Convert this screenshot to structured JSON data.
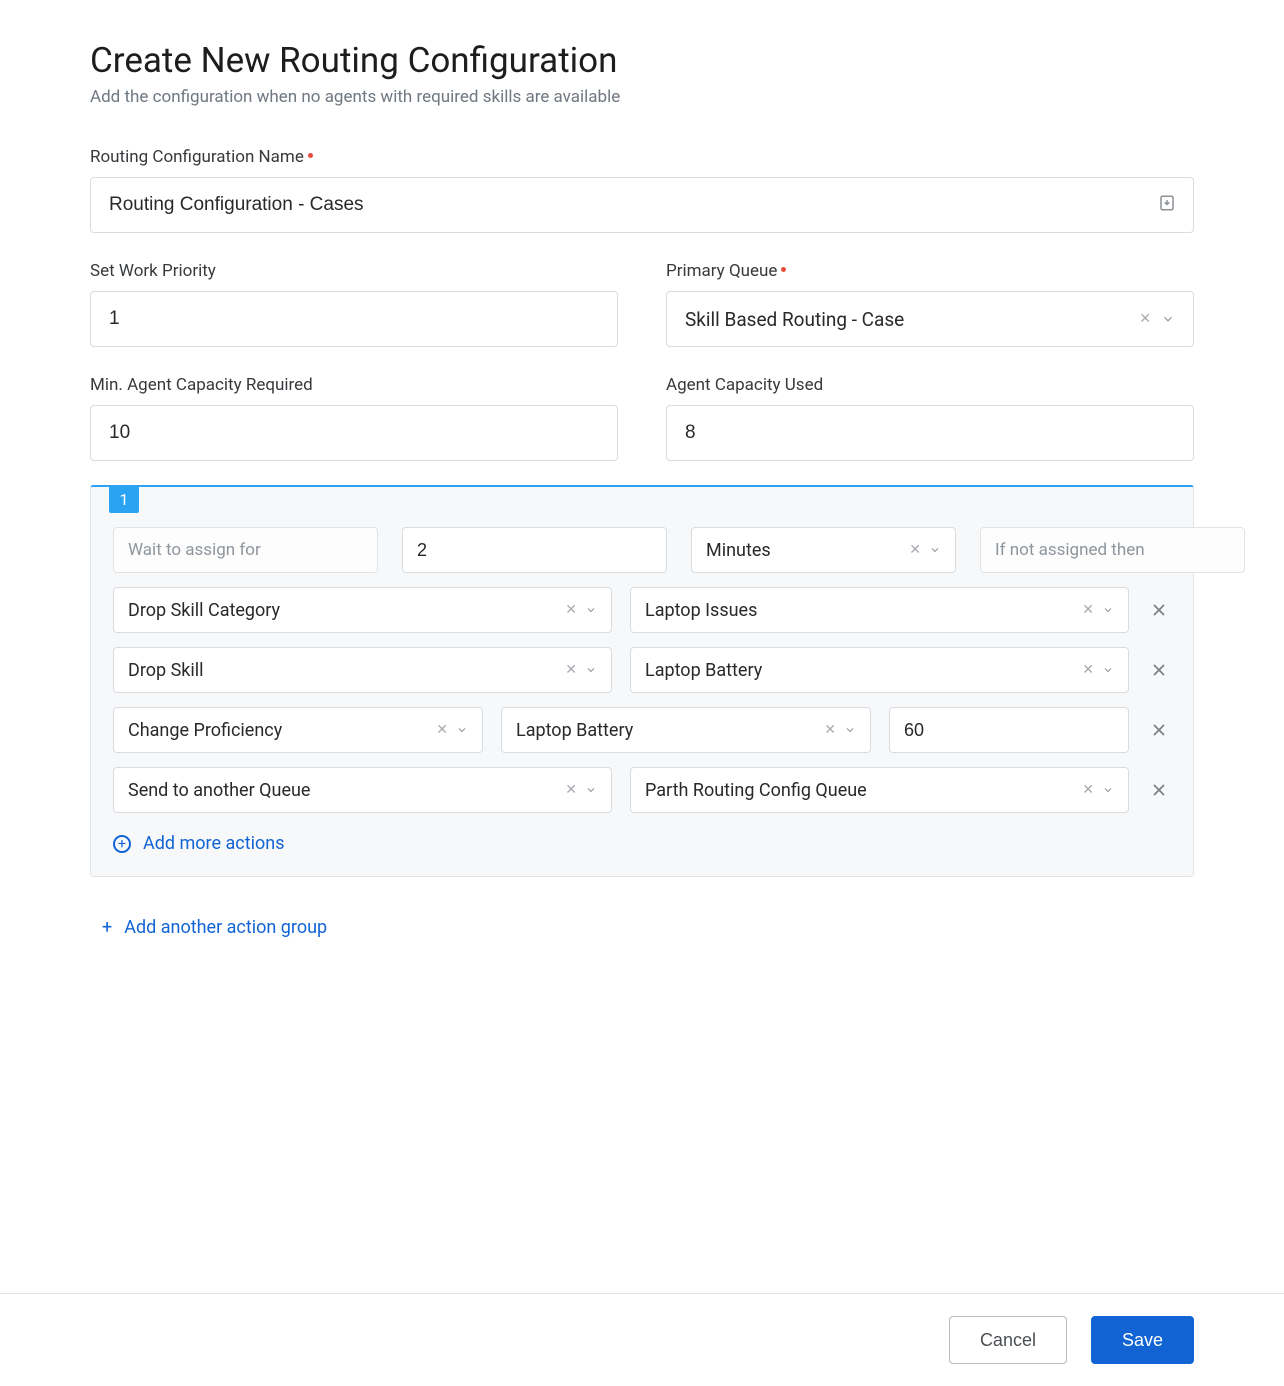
{
  "header": {
    "title": "Create New Routing Configuration",
    "subtitle": "Add the configuration when no agents with required skills are available"
  },
  "labels": {
    "routing_config_name": "Routing Configuration Name",
    "set_work_priority": "Set Work Priority",
    "primary_queue": "Primary Queue",
    "min_capacity": "Min. Agent Capacity Required",
    "capacity_used": "Agent Capacity Used"
  },
  "fields": {
    "routing_config_name": "Routing Configuration - Cases",
    "set_work_priority": "1",
    "primary_queue": "Skill Based Routing - Case",
    "min_capacity": "10",
    "capacity_used": "8"
  },
  "group": {
    "badge": "1",
    "wait_label": "Wait to assign for",
    "wait_value": "2",
    "wait_unit": "Minutes",
    "if_not_assigned_label": "If not assigned then",
    "actions": [
      {
        "type": "Drop Skill Category",
        "target": "Laptop Issues"
      },
      {
        "type": "Drop Skill",
        "target": "Laptop Battery"
      },
      {
        "type": "Change Proficiency",
        "target": "Laptop Battery",
        "value": "60"
      },
      {
        "type": "Send to another Queue",
        "target": "Parth Routing Config Queue"
      }
    ],
    "add_more_label": "Add more actions"
  },
  "add_group_label": "Add another action group",
  "footer": {
    "cancel": "Cancel",
    "save": "Save"
  }
}
